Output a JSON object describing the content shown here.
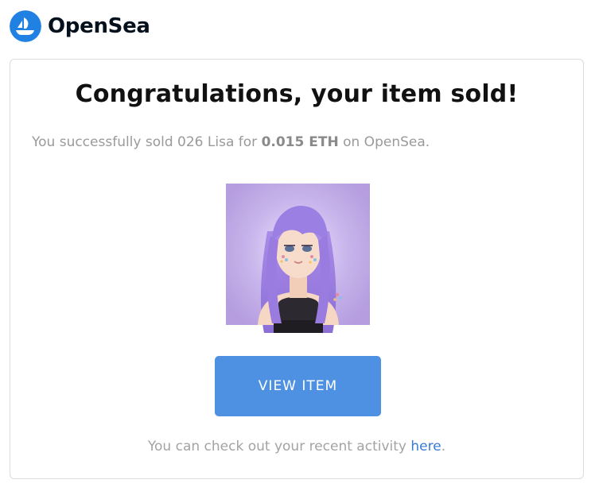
{
  "brand": {
    "name": "OpenSea",
    "logo_icon": "opensea-logo-icon",
    "color": "#2081e2"
  },
  "email": {
    "headline": "Congratulations, your item sold!",
    "message_prefix": "You successfully sold 026 Lisa for ",
    "amount": "0.015 ETH",
    "message_suffix": " on OpenSea.",
    "item_image_alt": "026 Lisa",
    "view_button_label": "VIEW ITEM",
    "footer_prefix": "You can check out your recent activity ",
    "footer_link": "here",
    "footer_suffix": ".",
    "accent_color": "#4e91e3"
  }
}
